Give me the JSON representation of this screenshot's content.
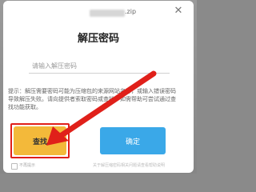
{
  "dialog": {
    "filename_ext": ".zip",
    "title": "解压密码",
    "password_placeholder": "请输入解压密码",
    "hint": "提示：解压需要密码可能为压缩包的来源网站名称，或输入错误密码导致解压失败。请向提供者索取密码或查找，如需帮助可尝试通过查找功能获取。",
    "find_label": "查找",
    "ok_label": "确定",
    "footer_left": "不再提示",
    "footer_right": "关于解压缩密码相关问题请查看帮助说明"
  },
  "colors": {
    "find_button": "#f3b93a",
    "ok_button": "#3aa8e8",
    "highlight_red": "#e0201a"
  }
}
